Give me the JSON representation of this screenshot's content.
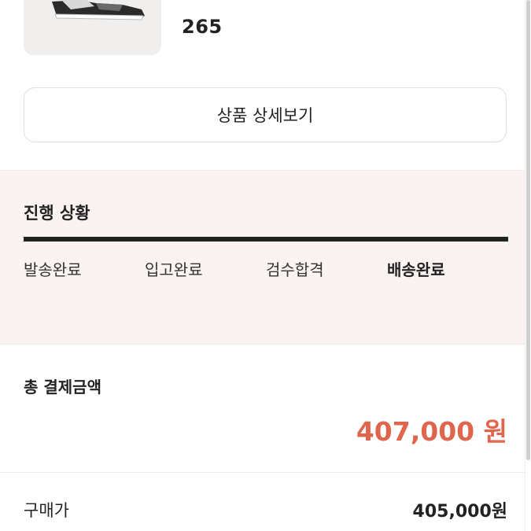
{
  "product": {
    "image_icon": "sneaker-image",
    "size": "265"
  },
  "detail_button": {
    "label": "상품 상세보기"
  },
  "progress": {
    "title": "진행 상황",
    "steps": [
      {
        "label": "발송완료",
        "active": false
      },
      {
        "label": "입고완료",
        "active": false
      },
      {
        "label": "검수합격",
        "active": false
      },
      {
        "label": "배송완료",
        "active": true
      }
    ],
    "completion": 1.0
  },
  "payment": {
    "total_label": "총 결제금액",
    "total_amount": "407,000 원",
    "purchase_label": "구매가",
    "purchase_value": "405,000원"
  },
  "colors": {
    "accent": "#e0654d",
    "progress_bg": "#faf3f2",
    "track": "#222222"
  }
}
